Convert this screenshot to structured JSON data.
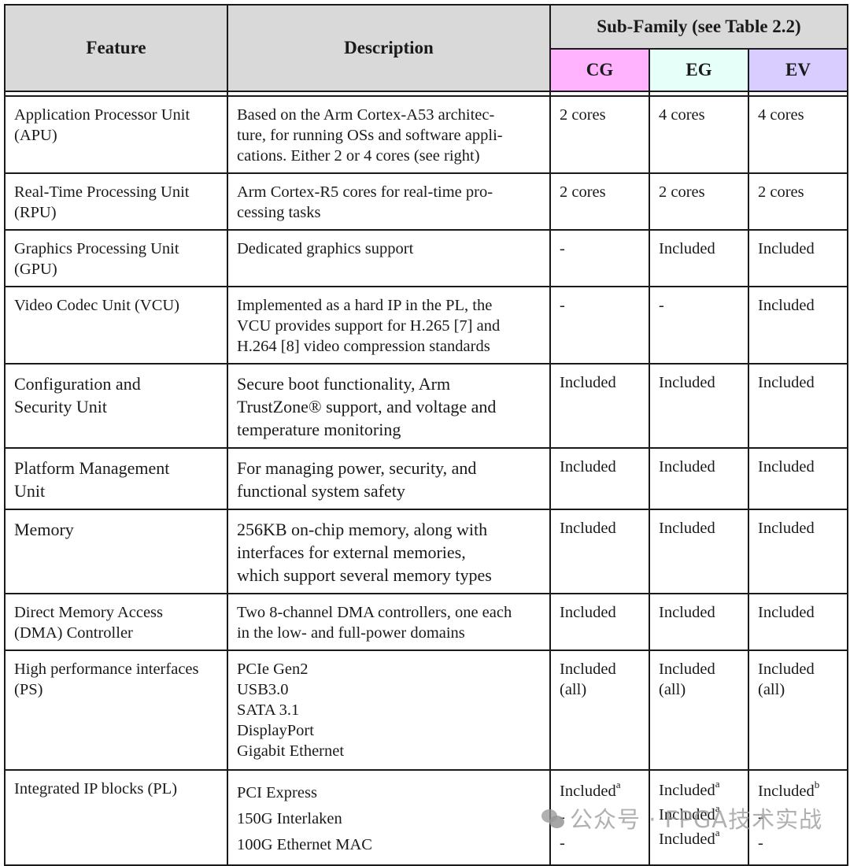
{
  "table": {
    "headers": {
      "feature": "Feature",
      "description": "Description",
      "sub_family": "Sub-Family (see Table 2.2)",
      "cg": "CG",
      "eg": "EG",
      "ev": "EV"
    },
    "header_colors": {
      "cg": "#ffb3ff",
      "eg": "#e6fff8",
      "ev": "#d9ccff",
      "main": "#d9d9d9"
    },
    "rows": [
      {
        "feature": [
          "Application Processor Unit",
          "(APU)"
        ],
        "description": [
          "Based on the Arm Cortex-A53 architec-",
          "ture, for running OSs and software appli-",
          "cations. Either 2 or 4 cores (see right)"
        ],
        "cg": "2 cores",
        "eg": "4 cores",
        "ev": "4 cores"
      },
      {
        "feature": [
          "Real-Time Processing Unit",
          "(RPU)"
        ],
        "description": [
          "Arm Cortex-R5 cores for real-time pro-",
          "cessing tasks"
        ],
        "cg": "2 cores",
        "eg": "2 cores",
        "ev": "2 cores"
      },
      {
        "feature": [
          "Graphics Processing Unit",
          "(GPU)"
        ],
        "description": [
          "Dedicated graphics support"
        ],
        "cg": "-",
        "eg": "Included",
        "ev": "Included"
      },
      {
        "feature": [
          "Video Codec Unit (VCU)"
        ],
        "description": [
          "Implemented as a hard IP in the PL, the",
          "VCU provides support for H.265 [7] and",
          "H.264 [8] video compression standards"
        ],
        "cg": "-",
        "eg": "-",
        "ev": "Included"
      },
      {
        "feature": [
          "Configuration and",
          "Security Unit"
        ],
        "description": [
          "Secure boot functionality, Arm",
          "TrustZone® support, and voltage and",
          "temperature monitoring"
        ],
        "cg": "Included",
        "eg": "Included",
        "ev": "Included"
      },
      {
        "feature": [
          "Platform Management",
          "Unit"
        ],
        "description": [
          "For managing power, security, and",
          "functional system safety"
        ],
        "cg": "Included",
        "eg": "Included",
        "ev": "Included"
      },
      {
        "feature": [
          "Memory"
        ],
        "description": [
          "256KB on-chip memory, along with",
          "interfaces for external memories,",
          "which support several memory types"
        ],
        "cg": "Included",
        "eg": "Included",
        "ev": "Included"
      },
      {
        "feature": [
          "Direct Memory Access",
          "(DMA) Controller"
        ],
        "description": [
          "Two 8-channel DMA controllers, one each",
          "in the low- and full-power domains"
        ],
        "cg": "Included",
        "eg": "Included",
        "ev": "Included"
      },
      {
        "feature": [
          "High performance interfaces",
          "(PS)"
        ],
        "description": [
          "PCIe Gen2",
          "USB3.0",
          "SATA 3.1",
          "DisplayPort",
          "Gigabit Ethernet"
        ],
        "cg": [
          "Included",
          "(all)"
        ],
        "eg": [
          "Included",
          "(all)"
        ],
        "ev": [
          "Included",
          "(all)"
        ]
      },
      {
        "feature": [
          "Integrated IP blocks (PL)"
        ],
        "description": [
          "PCI Express",
          "150G Interlaken",
          "100G Ethernet MAC"
        ],
        "cg": [
          {
            "text": "Included",
            "sup": "a"
          },
          {
            "text": "-",
            "sup": ""
          },
          {
            "text": "-",
            "sup": ""
          }
        ],
        "eg": [
          {
            "text": "Included",
            "sup": "a"
          },
          {
            "text": "Included",
            "sup": "a"
          },
          {
            "text": "Included",
            "sup": "a"
          }
        ],
        "ev": [
          {
            "text": "Included",
            "sup": "b"
          },
          {
            "text": "-",
            "sup": ""
          },
          {
            "text": "-",
            "sup": ""
          }
        ]
      }
    ]
  },
  "watermark": {
    "text": "公众号 · FPGA技术实战",
    "icon": "wechat-icon"
  }
}
